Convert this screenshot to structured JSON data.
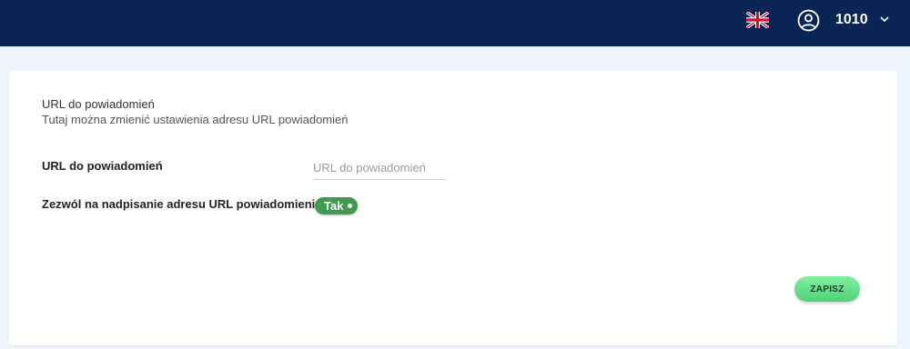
{
  "header": {
    "language_flag": "uk-flag-icon",
    "user_id": "1010"
  },
  "section": {
    "title": "URL do powiadomień",
    "subtitle": "Tutaj można zmienić ustawienia adresu URL powiadomień"
  },
  "form": {
    "url_label": "URL do powiadomień",
    "url_value": "",
    "url_placeholder": "URL do powiadomień",
    "override_label": "Zezwól na nadpisanie adresu URL powiadomienia",
    "override_toggle_text": "Tak",
    "override_toggle_on": true
  },
  "actions": {
    "save_label": "ZAPISZ"
  },
  "colors": {
    "topbar": "#0a2554",
    "toggle_on": "#3e9b4f",
    "save_button": "#5fdd85"
  }
}
